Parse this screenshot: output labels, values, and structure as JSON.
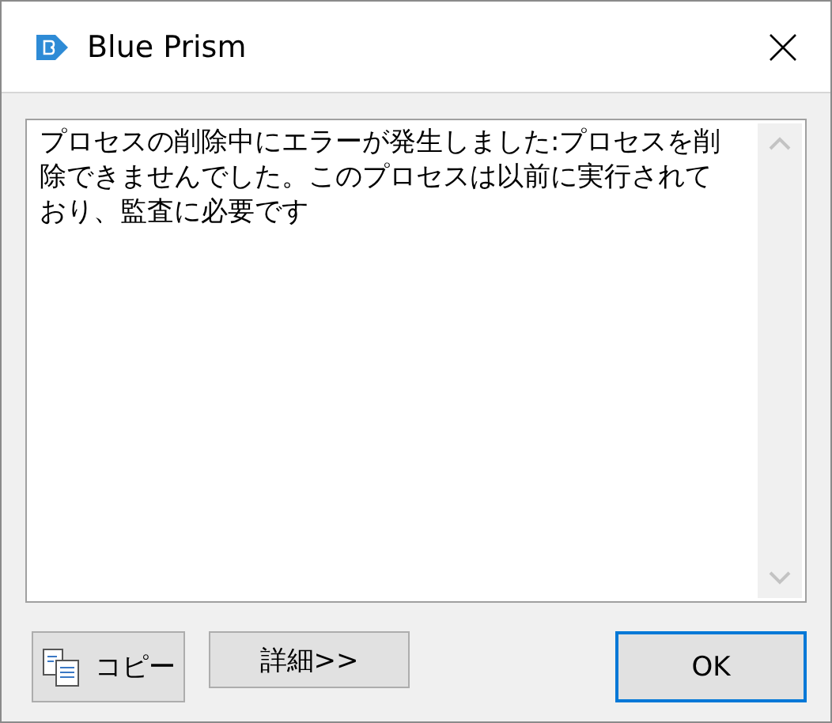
{
  "window": {
    "title": "Blue Prism"
  },
  "message": "プロセスの削除中にエラーが発生しました:プロセスを削除できませんでした。このプロセスは以前に実行されており、監査に必要です",
  "buttons": [
    {
      "label": "コピー",
      "kind": "copy",
      "default": false
    },
    {
      "label": "詳細>>",
      "kind": "details",
      "default": false
    },
    {
      "label": "OK",
      "kind": "ok",
      "default": true
    }
  ]
}
